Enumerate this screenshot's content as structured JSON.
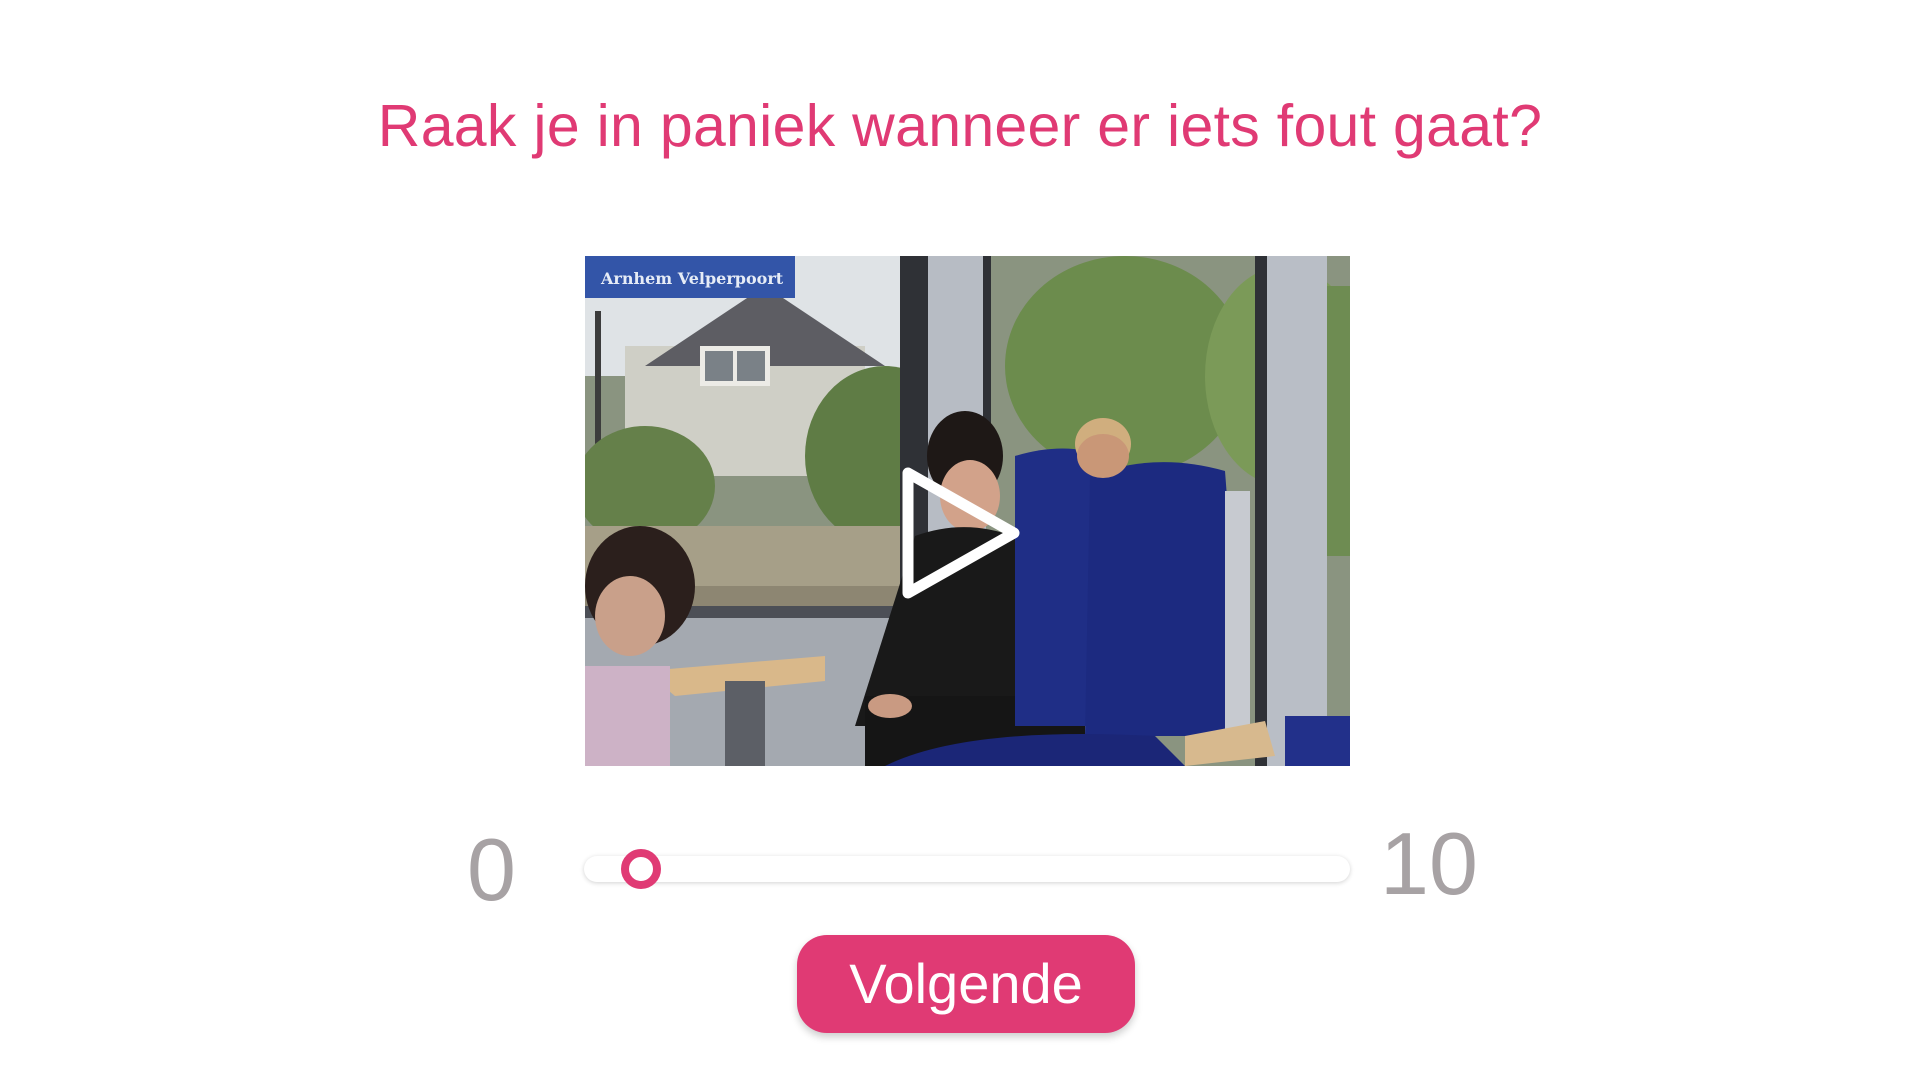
{
  "question": {
    "text": "Raak je in paniek wanneer er iets fout gaat?"
  },
  "video": {
    "station_sign": "Arnhem Velperpoort",
    "play_icon": "play-icon"
  },
  "scale": {
    "min_label": "0",
    "max_label": "10",
    "min": 0,
    "max": 10,
    "value": 0
  },
  "next_button": {
    "label": "Volgende"
  },
  "colors": {
    "accent": "#e03a74",
    "scale_label": "#a7a2a4"
  }
}
